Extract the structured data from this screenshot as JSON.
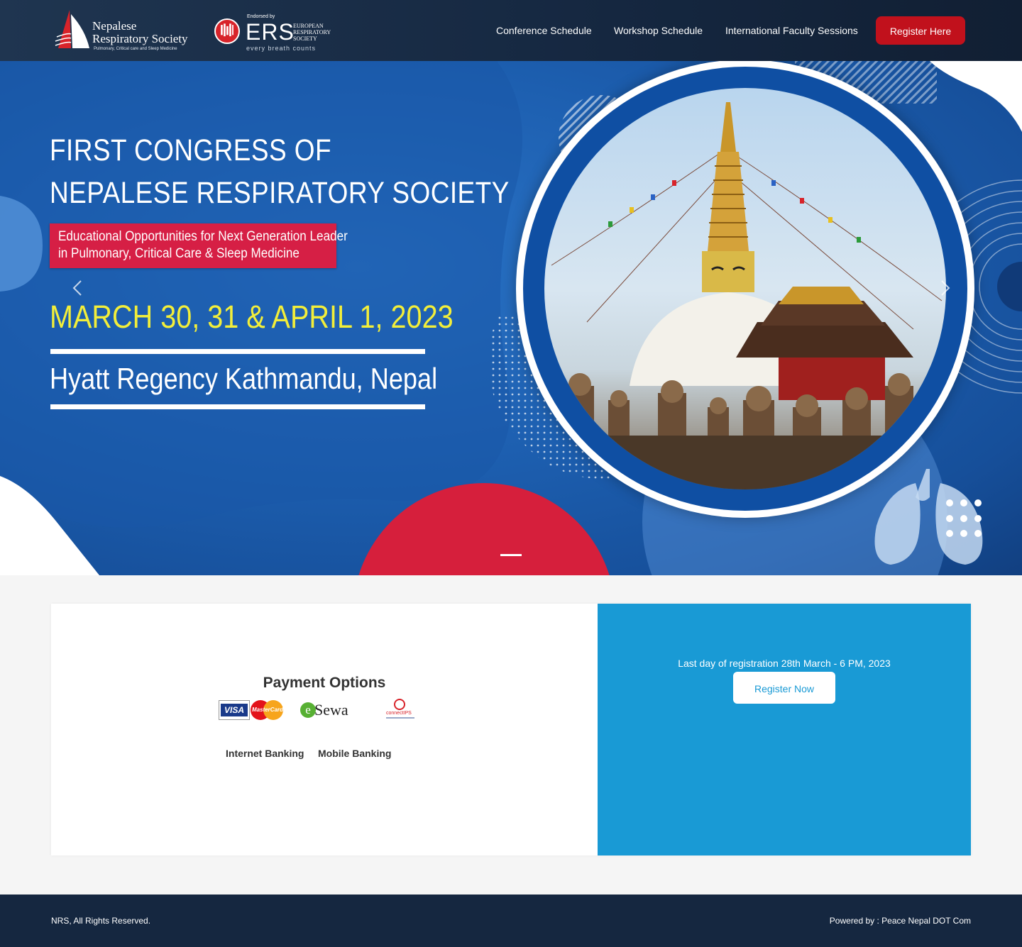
{
  "header": {
    "logo_nrs": {
      "line1": "Nepalese",
      "line2": "Respiratory Society",
      "subtitle": "Pulmonary, Critical care and Sleep Medicine"
    },
    "logo_ers": {
      "endorsed": "Endorsed by",
      "acronym": "ERS",
      "name_line1": "EUROPEAN",
      "name_line2": "RESPIRATORY",
      "name_line3": "SOCIETY",
      "tagline": "every breath counts"
    },
    "nav": [
      {
        "label": "Conference Schedule"
      },
      {
        "label": "Workshop Schedule"
      },
      {
        "label": "International Faculty Sessions"
      }
    ],
    "register_label": "Register Here",
    "register_color": "#c1111c"
  },
  "hero": {
    "title_line1": "FIRST CONGRESS OF",
    "title_line2": "NEPALESE RESPIRATORY SOCIETY",
    "tagline_line1": "Educational Opportunities for Next Generation Leader",
    "tagline_line2": "in Pulmonary, Critical Care & Sleep Medicine",
    "dates": "MARCH 30, 31  &  APRIL 1, 2023",
    "venue": "Hyatt Regency Kathmandu, Nepal",
    "colors": {
      "title": "#ffffff",
      "dates": "#f2ee3a",
      "tagline_bg": "#d61f45"
    },
    "icons": {
      "prev": "chevron-left-icon",
      "next": "chevron-right-icon",
      "decor": "lungs-icon"
    }
  },
  "payment": {
    "title": "Payment Options",
    "logos": {
      "visa": "VISA",
      "mastercard": "MasterCard",
      "esewa_e": "e",
      "esewa": "Sewa",
      "connectips": "connectIPS"
    },
    "methods": [
      "Internet Banking",
      "Mobile Banking"
    ]
  },
  "registration": {
    "deadline_text": "Last day of registration 28th March - 6 PM, 2023",
    "button_label": "Register Now",
    "panel_color": "#199ad5"
  },
  "footer": {
    "copyright": "NRS, All Rights Reserved.",
    "powered_by": "Powered by : Peace Nepal DOT Com"
  }
}
